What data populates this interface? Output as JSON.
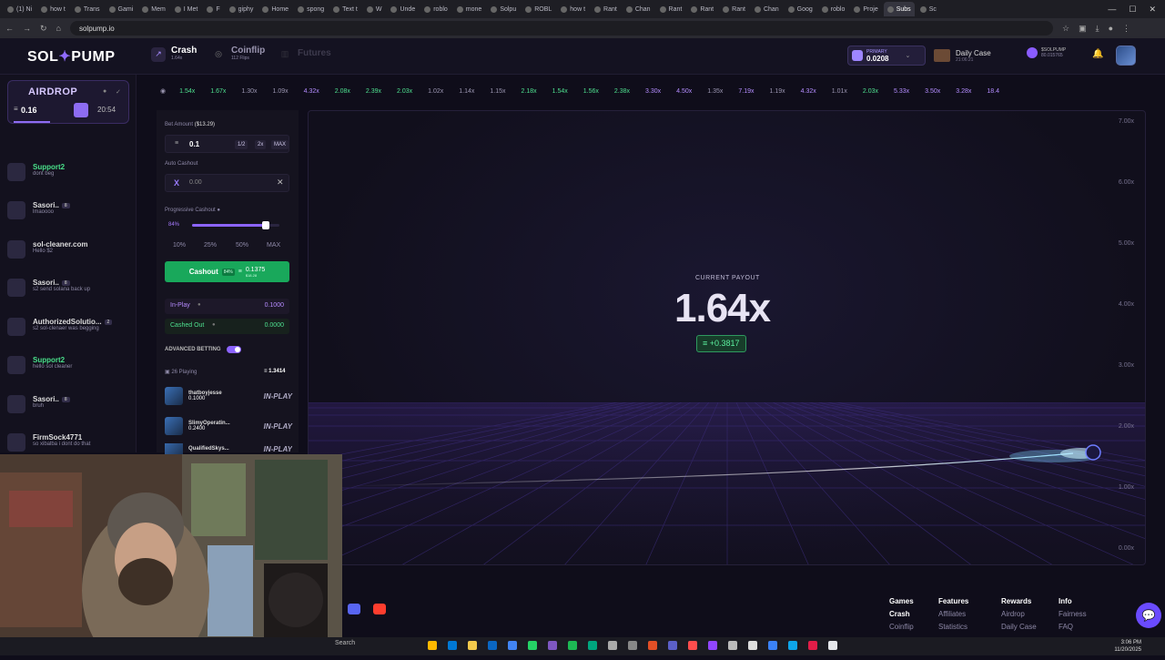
{
  "browser": {
    "tabs": [
      "(1) Ni",
      "how t",
      "Trans",
      "Gami",
      "Mem",
      "I Met",
      "F",
      "giphy",
      "Home",
      "spong",
      "Text t",
      "W",
      "Unde",
      "roblo",
      "mone",
      "Solpu",
      "ROBL",
      "how t",
      "Rant",
      "Chan",
      "Rant",
      "Rant",
      "Rant",
      "Chan",
      "Goog",
      "roblo",
      "Proje",
      "Subs",
      "Sc"
    ],
    "url": "solpump.io",
    "window_controls": [
      "—",
      "☐",
      "✕"
    ]
  },
  "header": {
    "logo_text_a": "SOL",
    "logo_text_b": "PUMP",
    "games": [
      {
        "title": "Crash",
        "sub": "1.64x"
      },
      {
        "title": "Coinflip",
        "sub": "112 Flips"
      },
      {
        "title": "Futures",
        "sub": ""
      }
    ],
    "balance_label": "PRIMARY",
    "balance_value": "0.0208",
    "daily_case_title": "Daily Case",
    "daily_case_sub": "21:06:21",
    "sol_level_title": "$SOLPUMP",
    "sol_level_sub": "80.015765"
  },
  "airdrop": {
    "title": "AIRDROP",
    "amount": "0.16",
    "timer": "20:54"
  },
  "chat": [
    {
      "name": "Support2",
      "badge": "",
      "text": "dont beg",
      "green": true
    },
    {
      "name": "Sasori..",
      "badge": "8",
      "text": "lmaoooo",
      "green": false
    },
    {
      "name": "sol-cleaner.com",
      "badge": "",
      "text": "Hello $2",
      "green": false
    },
    {
      "name": "Sasori..",
      "badge": "8",
      "text": "s2 send solana back up",
      "green": false
    },
    {
      "name": "AuthorizedSolutio...",
      "badge": "2",
      "text": "s2 sol-clenaer was begging",
      "green": false
    },
    {
      "name": "Support2",
      "badge": "",
      "text": "hello sol cleaner",
      "green": true
    },
    {
      "name": "Sasori..",
      "badge": "8",
      "text": "bruh",
      "green": false
    },
    {
      "name": "FirmSock4771",
      "badge": "",
      "text": "so xibalba i dont do that",
      "green": false
    }
  ],
  "bet": {
    "amount_label": "Bet Amount",
    "amount_usd": "($13.29)",
    "amount_value": "0.1",
    "half": "1/2",
    "double": "2x",
    "max": "MAX",
    "auto_label": "Auto Cashout",
    "auto_value": "0.00",
    "prog_label": "Progressive Cashout",
    "prog_pct": "84%",
    "prog_fill": 0.84,
    "pct_buttons": [
      "10%",
      "25%",
      "50%",
      "MAX"
    ],
    "cashout_label": "Cashout",
    "cashout_pct": "84%",
    "cashout_amount": "0.1375",
    "cashout_usd": "$18.28",
    "inplay_label": "In-Play",
    "inplay_value": "0.1000",
    "cashedout_label": "Cashed Out",
    "cashedout_value": "0.0000",
    "advanced_label": "ADVANCED BETTING",
    "playing_label": "26 Playing",
    "playing_total": "1.3414"
  },
  "players": [
    {
      "name": "thatboyjesse",
      "amount": "0.1000",
      "status": "IN-PLAY"
    },
    {
      "name": "SlimyOperatin...",
      "amount": "0.2400",
      "status": "IN-PLAY"
    },
    {
      "name": "QualifiedSkys...",
      "amount": "",
      "status": "IN-PLAY"
    }
  ],
  "history": [
    {
      "v": "1.54x",
      "c": "green"
    },
    {
      "v": "1.67x",
      "c": "green"
    },
    {
      "v": "1.30x",
      "c": "gray"
    },
    {
      "v": "1.09x",
      "c": "gray"
    },
    {
      "v": "4.32x",
      "c": "purple"
    },
    {
      "v": "2.08x",
      "c": "green"
    },
    {
      "v": "2.39x",
      "c": "green"
    },
    {
      "v": "2.03x",
      "c": "green"
    },
    {
      "v": "1.02x",
      "c": "gray"
    },
    {
      "v": "1.14x",
      "c": "gray"
    },
    {
      "v": "1.15x",
      "c": "gray"
    },
    {
      "v": "2.18x",
      "c": "green"
    },
    {
      "v": "1.54x",
      "c": "green"
    },
    {
      "v": "1.56x",
      "c": "green"
    },
    {
      "v": "2.38x",
      "c": "green"
    },
    {
      "v": "3.30x",
      "c": "purple"
    },
    {
      "v": "4.50x",
      "c": "purple"
    },
    {
      "v": "1.35x",
      "c": "gray"
    },
    {
      "v": "7.19x",
      "c": "purple"
    },
    {
      "v": "1.19x",
      "c": "gray"
    },
    {
      "v": "4.32x",
      "c": "purple"
    },
    {
      "v": "1.01x",
      "c": "gray"
    },
    {
      "v": "2.03x",
      "c": "green"
    },
    {
      "v": "5.33x",
      "c": "purple"
    },
    {
      "v": "3.50x",
      "c": "purple"
    },
    {
      "v": "3.28x",
      "c": "purple"
    },
    {
      "v": "18.4",
      "c": "purple"
    }
  ],
  "game": {
    "payout_label": "CURRENT PAYOUT",
    "payout_value": "1.64x",
    "gain": "+0.3817",
    "y_ticks": [
      "7.00x",
      "6.00x",
      "5.00x",
      "4.00x",
      "3.00x",
      "2.00x",
      "1.00x",
      "0.00x"
    ]
  },
  "footer": {
    "columns": [
      {
        "head": "Games",
        "items": [
          "Crash",
          "Coinflip"
        ]
      },
      {
        "head": "Features",
        "items": [
          "Affiliates",
          "Statistics"
        ]
      },
      {
        "head": "Rewards",
        "items": [
          "Airdrop",
          "Daily Case"
        ]
      },
      {
        "head": "Info",
        "items": [
          "Fairness",
          "FAQ"
        ]
      }
    ]
  },
  "taskbar": {
    "search": "Search",
    "time": "3:06 PM",
    "date": "11/20/2025"
  }
}
